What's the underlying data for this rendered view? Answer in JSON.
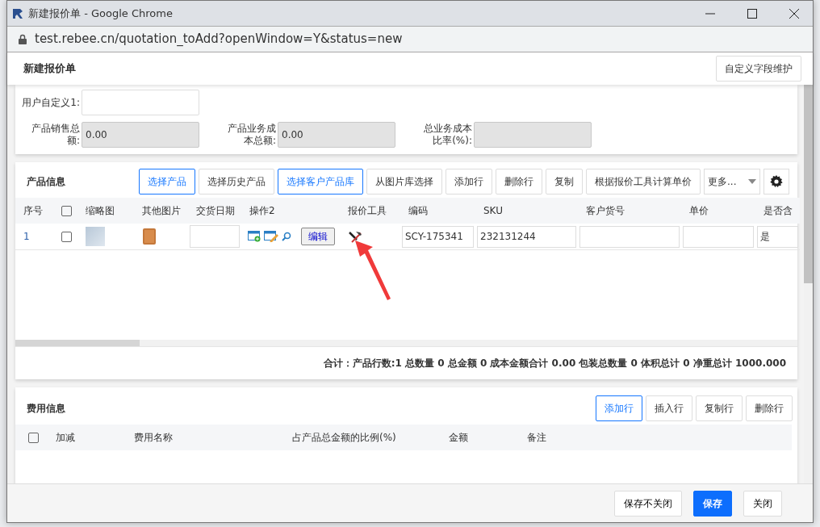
{
  "window": {
    "title": "新建报价单 - Google Chrome",
    "url": "test.rebee.cn/quotation_toAdd?openWindow=Y&status=new"
  },
  "header": {
    "title": "新建报价单",
    "button": "自定义字段维护"
  },
  "fields": [
    {
      "label": "用户自定义1:",
      "readonly": false
    },
    {
      "label": "产品销售总额:",
      "value": "0.00",
      "readonly": true
    },
    {
      "label": "产品业务成本总额:",
      "value": "0.00",
      "readonly": true
    },
    {
      "label": "总业务成本比率(%):",
      "readonly": true
    }
  ],
  "products": {
    "title": "产品信息",
    "buttons": [
      {
        "label": "选择产品",
        "highlighted": true
      },
      {
        "label": "选择历史产品",
        "highlighted": false
      },
      {
        "label": "选择客户产品库",
        "highlighted": true
      },
      {
        "label": "从图片库选择",
        "highlighted": false
      },
      {
        "label": "添加行",
        "highlighted": false
      },
      {
        "label": "删除行",
        "highlighted": false
      },
      {
        "label": "复制",
        "highlighted": false
      },
      {
        "label": "根据报价工具计算单价",
        "highlighted": false
      }
    ],
    "more": "更多...",
    "columns": [
      "序号",
      "",
      "缩略图",
      "其他图片",
      "交货日期",
      "操作2",
      "报价工具",
      "编码",
      "SKU",
      "客户货号",
      "单价",
      "是否含"
    ],
    "header_checked": false,
    "rows": [
      {
        "index": "1",
        "checked": false,
        "delivery_date": "",
        "edit": "编辑",
        "code": "SCY-175341",
        "sku": "232131244",
        "customer_no": "",
        "price": "",
        "tax": "是"
      }
    ],
    "summary": "合计：产品行数:1 总数量 0 总金额 0 成本金额合计 0.00 包装总数量 0 体积总计 0 净重总计 1000.000"
  },
  "fees": {
    "title": "费用信息",
    "buttons": [
      {
        "label": "添加行",
        "highlighted": true
      },
      {
        "label": "插入行",
        "highlighted": false
      },
      {
        "label": "复制行",
        "highlighted": false
      },
      {
        "label": "删除行",
        "highlighted": false
      }
    ],
    "header_checked": false,
    "columns": [
      "加减",
      "费用名称",
      "占产品总金额的比例(%)",
      "金额",
      "备注"
    ]
  },
  "footer": [
    {
      "label": "保存不关闭",
      "kind": "default"
    },
    {
      "label": "保存",
      "kind": "primary"
    },
    {
      "label": "关闭",
      "kind": "default"
    }
  ]
}
